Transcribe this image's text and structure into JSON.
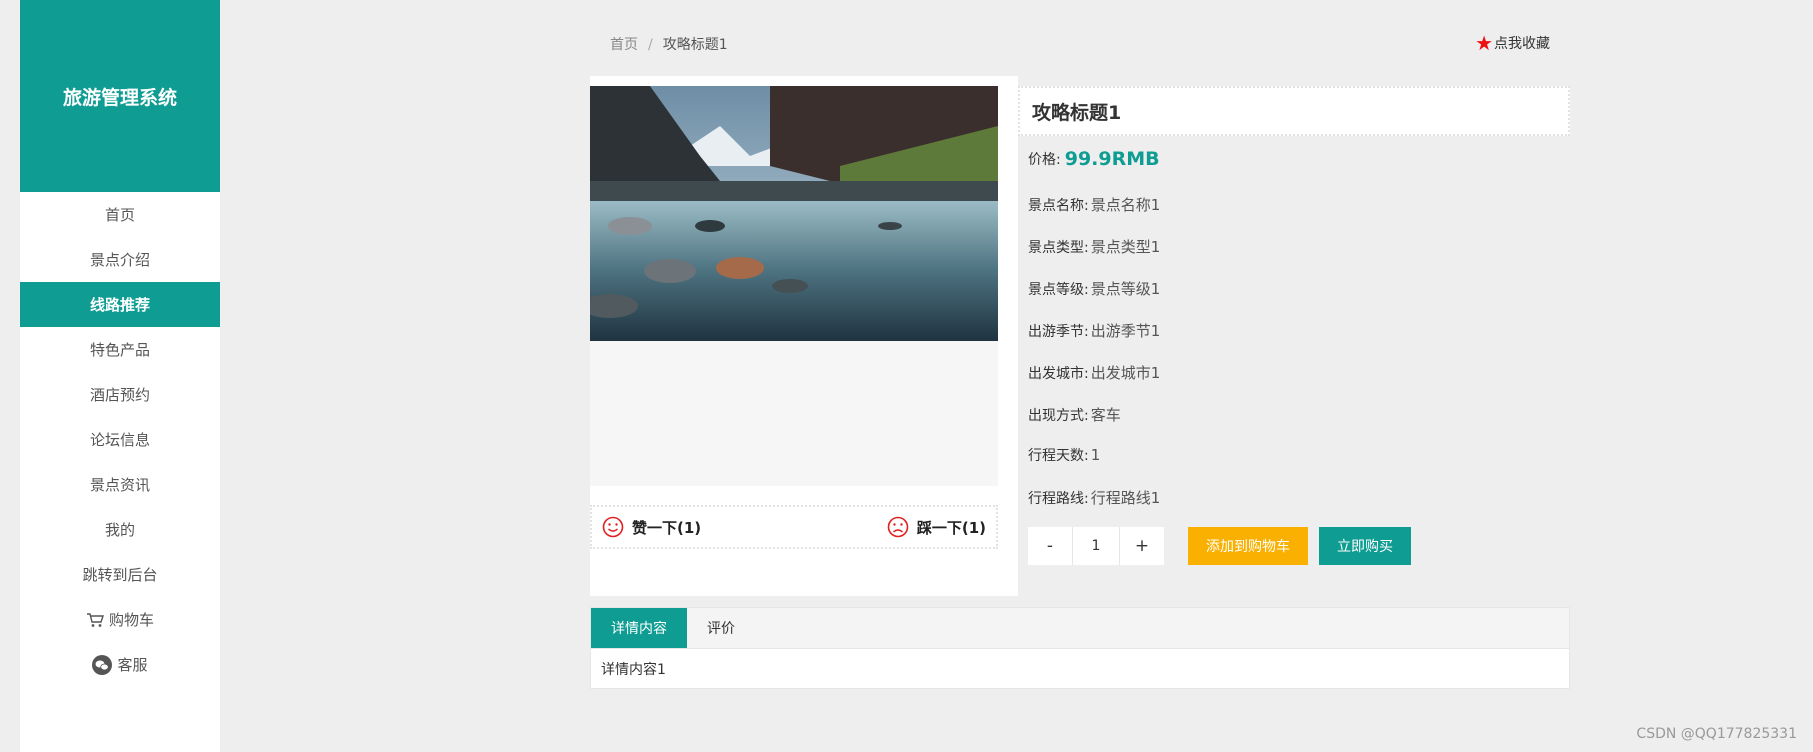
{
  "brand": "旅游管理系统",
  "nav": [
    {
      "label": "首页",
      "icon": ""
    },
    {
      "label": "景点介绍",
      "icon": ""
    },
    {
      "label": "线路推荐",
      "icon": ""
    },
    {
      "label": "特色产品",
      "icon": ""
    },
    {
      "label": "酒店预约",
      "icon": ""
    },
    {
      "label": "论坛信息",
      "icon": ""
    },
    {
      "label": "景点资讯",
      "icon": ""
    },
    {
      "label": "我的",
      "icon": ""
    },
    {
      "label": "跳转到后台",
      "icon": ""
    },
    {
      "label": "购物车",
      "icon": "cart-icon"
    },
    {
      "label": "客服",
      "icon": "wechat-icon"
    }
  ],
  "breadcrumb": {
    "home": "首页",
    "separator": "/",
    "current": "攻略标题1"
  },
  "favorite": "点我收藏",
  "votes": {
    "like": "赞一下(1)",
    "dislike": "踩一下(1)"
  },
  "product": {
    "title": "攻略标题1",
    "price_label": "价格:",
    "price": "99.9RMB",
    "details": [
      {
        "label": "景点名称:",
        "value": "景点名称1"
      },
      {
        "label": "景点类型:",
        "value": "景点类型1"
      },
      {
        "label": "景点等级:",
        "value": "景点等级1"
      },
      {
        "label": "出游季节:",
        "value": "出游季节1"
      },
      {
        "label": "出发城市:",
        "value": "出发城市1"
      },
      {
        "label": "出现方式:",
        "value": "客车"
      },
      {
        "label": "行程天数:",
        "value": "1"
      },
      {
        "label": "行程路线:",
        "value": "行程路线1"
      }
    ]
  },
  "quantity": {
    "minus": "-",
    "value": "1",
    "plus": "+"
  },
  "buttons": {
    "add_cart": "添加到购物车",
    "buy_now": "立即购买"
  },
  "tabs": [
    {
      "label": "详情内容"
    },
    {
      "label": "评价"
    }
  ],
  "tab_content": "详情内容1",
  "watermark": "CSDN @QQ177825331",
  "colors": {
    "accent": "#0f9d93",
    "cart_button": "#f9b000",
    "favorite_star": "#ee1111"
  }
}
